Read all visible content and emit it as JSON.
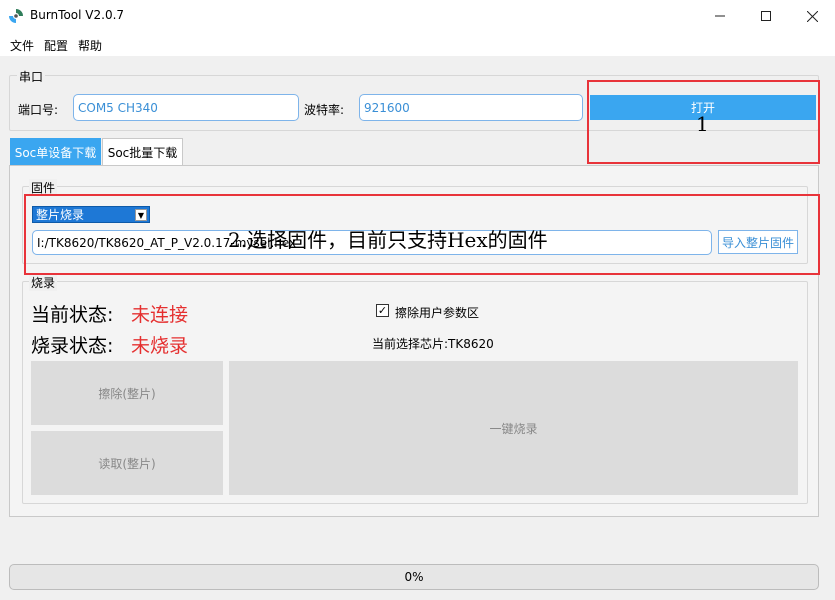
{
  "window": {
    "title": "BurnTool V2.0.7"
  },
  "menu": {
    "items": [
      "文件",
      "配置",
      "帮助"
    ]
  },
  "serial": {
    "group_title": "串口",
    "port_label": "端口号:",
    "port_value": "COM5  CH340",
    "baud_label": "波特率:",
    "baud_value": "921600",
    "open_label": "打开"
  },
  "tabs": [
    "Soc单设备下载",
    "Soc批量下载"
  ],
  "firmware": {
    "group_title": "固件",
    "mode_value": "整片烧录",
    "path_value": "I:/TK8620/TK8620_AT_P_V2.0.17-mysel.hex",
    "import_label": "导入整片固件"
  },
  "burn": {
    "group_title": "烧录",
    "current_status_label": "当前状态:",
    "current_status_value": "未连接",
    "burn_status_label": "烧录状态:",
    "burn_status_value": "未烧录",
    "erase_user_label": "擦除用户参数区",
    "erase_user_checked": true,
    "chip_label": "当前选择芯片:TK8620",
    "erase_button": "擦除(整片)",
    "read_button": "读取(整片)",
    "one_key_button": "一键烧录"
  },
  "progress": {
    "value": 0,
    "label": "0%"
  },
  "annotations": {
    "step1": "1",
    "step2": "2.选择固件，目前只支持Hex的固件"
  },
  "colors": {
    "accent": "#3aa6f0",
    "annotation": "#e8333a",
    "status_red": "#e53030"
  }
}
